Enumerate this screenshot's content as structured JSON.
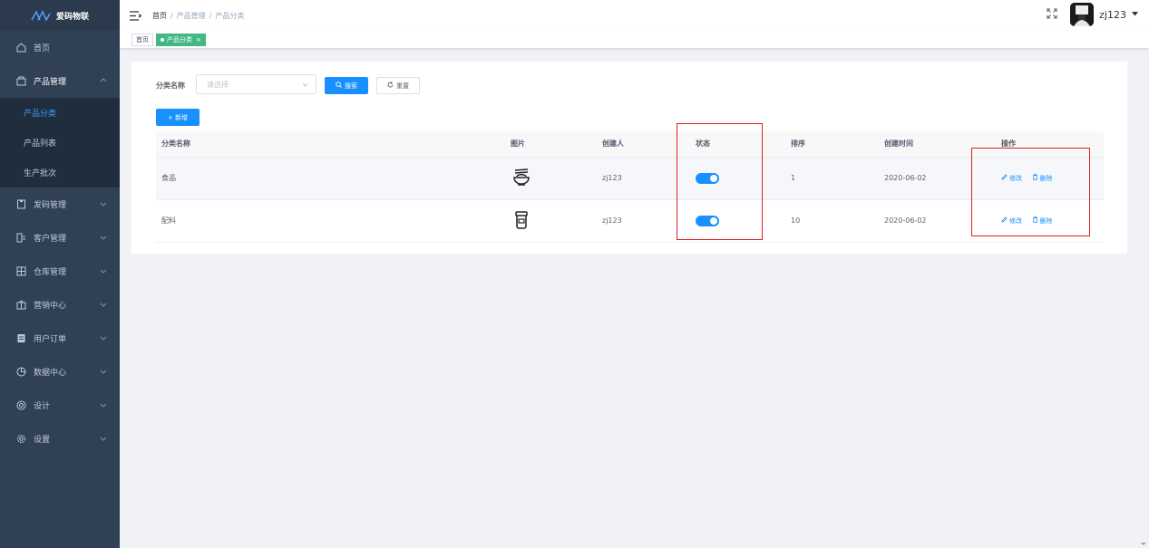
{
  "app": {
    "title": "爱码物联"
  },
  "sidebar": {
    "items": [
      {
        "label": "首页",
        "icon": "home-icon"
      },
      {
        "label": "产品管理",
        "icon": "box-icon",
        "expanded": true,
        "children": [
          {
            "label": "产品分类",
            "active": true
          },
          {
            "label": "产品列表"
          },
          {
            "label": "生产批次"
          }
        ]
      },
      {
        "label": "发码管理",
        "icon": "qrcode-icon"
      },
      {
        "label": "客户管理",
        "icon": "customer-icon"
      },
      {
        "label": "仓库管理",
        "icon": "warehouse-icon"
      },
      {
        "label": "营销中心",
        "icon": "marketing-icon"
      },
      {
        "label": "用户订单",
        "icon": "order-icon"
      },
      {
        "label": "数据中心",
        "icon": "chart-icon"
      },
      {
        "label": "设计",
        "icon": "design-icon"
      },
      {
        "label": "设置",
        "icon": "gear-icon"
      }
    ]
  },
  "navbar": {
    "breadcrumb": [
      "首页",
      "产品管理",
      "产品分类"
    ],
    "separator": "/",
    "username": "zj123"
  },
  "tags": [
    {
      "label": "首页"
    },
    {
      "label": "产品分类",
      "active": true,
      "close": "×"
    }
  ],
  "filter": {
    "label": "分类名称",
    "placeholder": "请选择",
    "search_label": "搜索",
    "reset_label": "重置"
  },
  "toolbar": {
    "add_label": "+ 新增"
  },
  "table": {
    "headers": [
      "分类名称",
      "图片",
      "创建人",
      "状态",
      "排序",
      "创建时间",
      "操作"
    ],
    "rows": [
      {
        "name": "食品",
        "icon": "noodle-bowl-icon",
        "creator": "zj123",
        "status": true,
        "sort": "1",
        "created": "2020-06-02"
      },
      {
        "name": "配料",
        "icon": "jar-icon",
        "creator": "zj123",
        "status": true,
        "sort": "10",
        "created": "2020-06-02"
      }
    ],
    "actions": {
      "edit": "修改",
      "delete": "删除"
    }
  },
  "colors": {
    "primary": "#1890ff",
    "sidebar": "#304156",
    "tag_active": "#42b983",
    "highlight": "#e02020"
  }
}
